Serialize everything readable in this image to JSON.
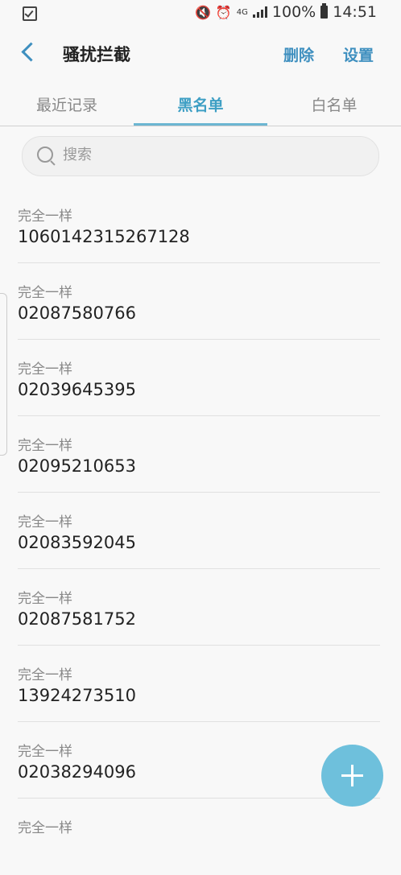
{
  "status_bar": {
    "network": "4G",
    "battery": "100%",
    "time": "14:51"
  },
  "app_bar": {
    "title": "骚扰拦截",
    "delete_label": "删除",
    "settings_label": "设置"
  },
  "tabs": [
    {
      "label": "最近记录",
      "active": false
    },
    {
      "label": "黑名单",
      "active": true
    },
    {
      "label": "白名单",
      "active": false
    }
  ],
  "search": {
    "placeholder": "搜索"
  },
  "blacklist": [
    {
      "match": "完全一样",
      "number": "1060142315267128"
    },
    {
      "match": "完全一样",
      "number": "02087580766"
    },
    {
      "match": "完全一样",
      "number": "02039645395"
    },
    {
      "match": "完全一样",
      "number": "02095210653"
    },
    {
      "match": "完全一样",
      "number": "02083592045"
    },
    {
      "match": "完全一样",
      "number": "02087581752"
    },
    {
      "match": "完全一样",
      "number": "13924273510"
    },
    {
      "match": "完全一样",
      "number": "02038294096"
    },
    {
      "match": "完全一样",
      "number": ""
    }
  ],
  "colors": {
    "accent": "#3e8fbf",
    "fab": "#6ec0dc"
  }
}
